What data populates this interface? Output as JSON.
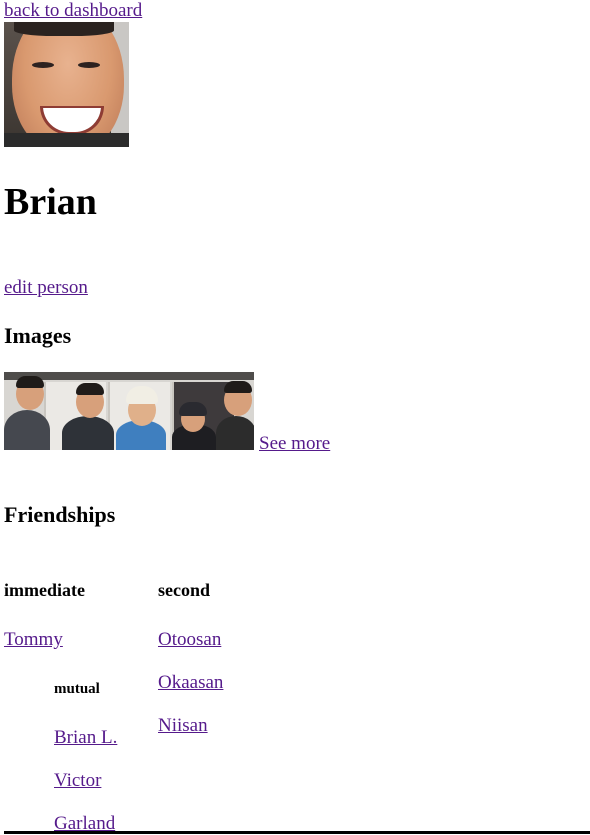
{
  "nav": {
    "back_label": "back to dashboard"
  },
  "person": {
    "name": "Brian",
    "edit_label": "edit person"
  },
  "images": {
    "heading": "Images",
    "see_more_label": "See more"
  },
  "friendships": {
    "heading": "Friendships",
    "immediate": {
      "heading": "immediate",
      "friends": [
        {
          "name": "Tommy",
          "mutual": {
            "heading": "mutual",
            "names": [
              "Brian L.",
              "Victor",
              "Garland"
            ]
          }
        }
      ]
    },
    "second": {
      "heading": "second",
      "names": [
        "Otoosan",
        "Okaasan",
        "Niisan"
      ]
    }
  },
  "colors": {
    "link_visited": "#551a8b",
    "text": "#000000",
    "background": "#ffffff"
  }
}
